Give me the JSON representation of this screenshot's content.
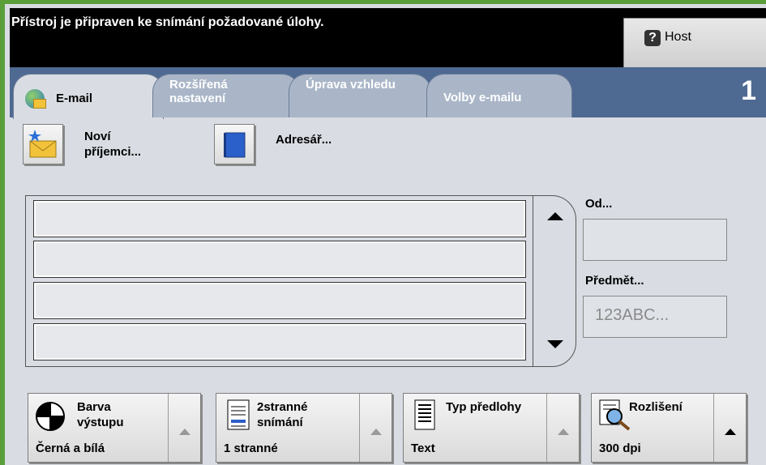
{
  "status": {
    "message": "Přístroj je připraven ke snímání požadované úlohy."
  },
  "help": {
    "label": "Host",
    "icon": "?"
  },
  "tabs": [
    {
      "label": "E-mail"
    },
    {
      "label_line1": "Rozšířená",
      "label_line2": "nastavení"
    },
    {
      "label": "Úprava vzhledu"
    },
    {
      "label": "Volby e-mailu"
    }
  ],
  "copy_count": "1",
  "actions": {
    "new_recipients": {
      "line1": "Noví",
      "line2": "příjemci..."
    },
    "address_book": {
      "label": "Adresář..."
    }
  },
  "fields": {
    "from_label": "Od...",
    "from_value": "",
    "subject_label": "Předmět...",
    "subject_placeholder": "123ABC..."
  },
  "bottom": [
    {
      "line1": "Barva",
      "line2": "výstupu",
      "value": "Černá a bílá"
    },
    {
      "line1": "2stranné",
      "line2": "snímání",
      "value": "1 stranné"
    },
    {
      "line1": "Typ předlohy",
      "value": "Text"
    },
    {
      "line1": "Rozlišení",
      "value": "300 dpi"
    }
  ],
  "colors": {
    "accent_green": "#5a9e3a",
    "tab_blue": "#4e6a92"
  }
}
